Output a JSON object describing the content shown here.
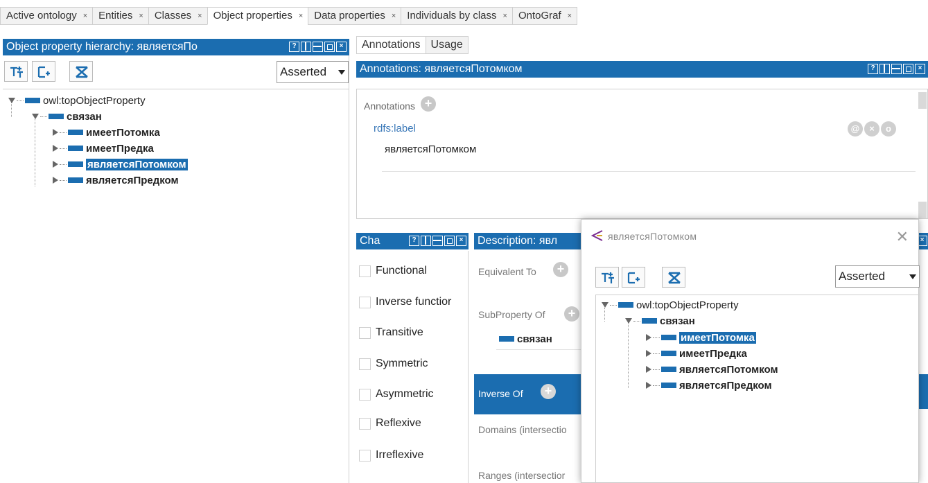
{
  "tabs": [
    {
      "label": "Active ontology",
      "close": "×"
    },
    {
      "label": "Entities",
      "close": "×"
    },
    {
      "label": "Classes",
      "close": "×"
    },
    {
      "label": "Object properties",
      "close": "×",
      "active": true
    },
    {
      "label": "Data properties",
      "close": "×"
    },
    {
      "label": "Individuals by class",
      "close": "×"
    },
    {
      "label": "OntoGraf",
      "close": "×"
    }
  ],
  "hierarchy": {
    "title": "Object property hierarchy: являетсяПо",
    "mode": "Asserted",
    "tree": {
      "root": "owl:topObjectProperty",
      "child": "связан",
      "leaves": [
        "имеетПотомка",
        "имеетПредка",
        "являетсяПотомком",
        "являетсяПредком"
      ]
    }
  },
  "right_tabs": {
    "annotations": "Annotations",
    "usage": "Usage"
  },
  "annotations_panel": {
    "title": "Annotations: являетсяПотомком",
    "section_label": "Annotations",
    "property": "rdfs:label",
    "value": "являетсяПотомком",
    "btn_at": "@",
    "btn_x": "×",
    "btn_o": "o"
  },
  "characteristics": {
    "title": "Cha",
    "items": [
      "Functional",
      "Inverse functior",
      "Transitive",
      "Symmetric",
      "Asymmetric",
      "Reflexive",
      "Irreflexive"
    ]
  },
  "description": {
    "title": "Description: явл",
    "equivalent": "Equivalent To",
    "subproperty": "SubProperty Of",
    "subproperty_value": "связан",
    "inverse": "Inverse Of",
    "domains": "Domains (intersectio",
    "ranges": "Ranges (intersectior"
  },
  "dialog": {
    "title": "являетсяПотомком",
    "mode": "Asserted",
    "tree": {
      "root": "owl:topObjectProperty",
      "child": "связан",
      "leaves": [
        "имеетПотомка",
        "имеетПредка",
        "являетсяПотомком",
        "являетсяПредком"
      ]
    }
  },
  "colors": {
    "accent": "#1b6db0"
  }
}
